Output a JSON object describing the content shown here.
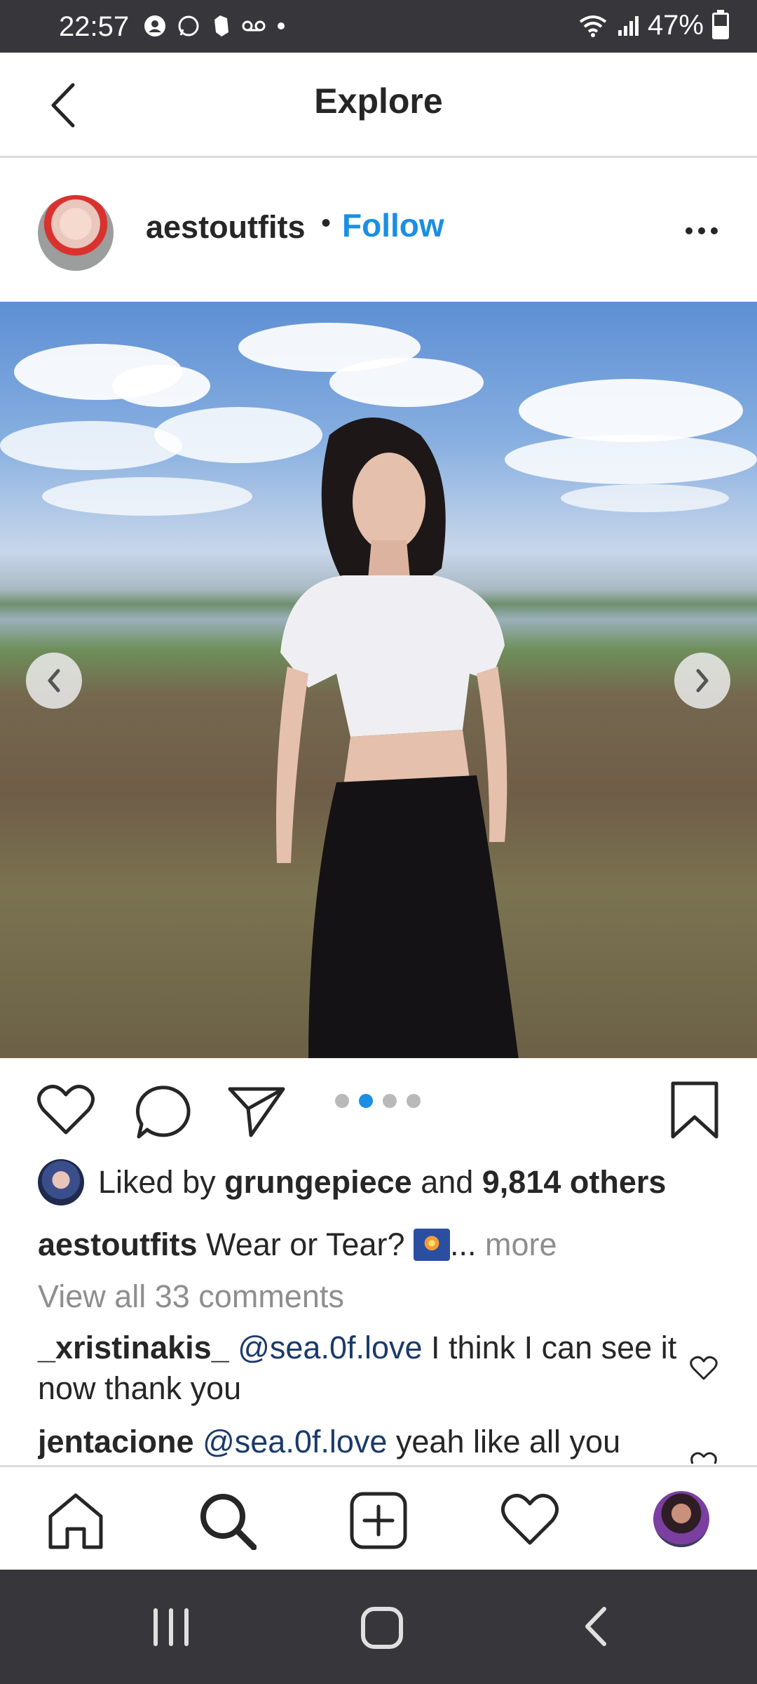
{
  "status_bar": {
    "time": "22:57",
    "battery": "47%"
  },
  "header": {
    "title": "Explore"
  },
  "post": {
    "username": "aestoutfits",
    "separator": "•",
    "follow_label": "Follow",
    "pager": {
      "count": 4,
      "active_index": 1
    }
  },
  "likes": {
    "prefix": "Liked by ",
    "user": "grungepiece",
    "middle": " and ",
    "count_text": "9,814 others"
  },
  "caption": {
    "user": "aestoutfits",
    "text": " Wear or Tear? ",
    "ellipsis": "...",
    "more": " more"
  },
  "view_all_comments": "View all 33 comments",
  "comments": [
    {
      "user": "_xristinakis_",
      "mention": "@sea.0f.love",
      "text": " I think I can see it now thank you"
    },
    {
      "user": "jentacione",
      "mention": "@sea.0f.love",
      "text": " yeah like all you"
    }
  ],
  "colors": {
    "accent": "#1a8fe3",
    "status_bar": "#37373b",
    "text": "#262626",
    "muted": "#8e8e8e"
  },
  "icons": [
    "back-arrow-icon",
    "more-options-icon",
    "heart-icon",
    "comment-icon",
    "share-icon",
    "bookmark-icon",
    "home-icon",
    "search-icon",
    "add-post-icon",
    "activity-heart-icon",
    "profile-avatar"
  ]
}
